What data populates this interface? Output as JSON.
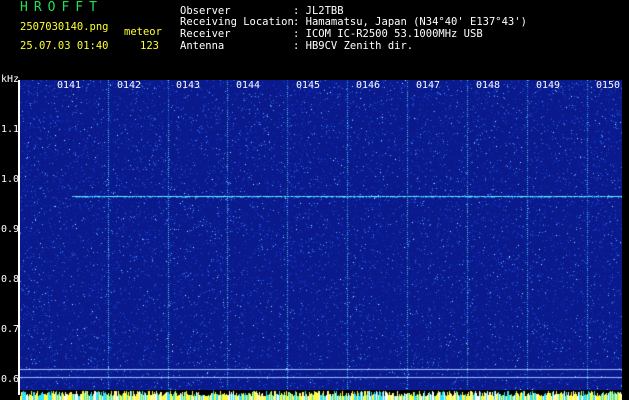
{
  "header": {
    "app_name": "HROFFT",
    "filename": "2507030140.png",
    "datetime": "25.07.03 01:40",
    "event_type": "meteor",
    "count": "123",
    "fields": [
      {
        "label": "Observer",
        "value": ": JL2TBB"
      },
      {
        "label": "Receiving Location",
        "value": ": Hamamatsu, Japan (N34°40' E137°43')"
      },
      {
        "label": "Receiver",
        "value": ": ICOM IC-R2500 53.1000MHz USB"
      },
      {
        "label": "Antenna",
        "value": ": HB9CV Zenith dir."
      }
    ]
  },
  "spectrogram": {
    "y_unit": "kHz",
    "y_ticks": [
      "1.1",
      "1.0",
      "0.9",
      "0.8",
      "0.7",
      "0.6"
    ],
    "time_labels": [
      "0141",
      "0142",
      "0143",
      "0144",
      "0145",
      "0146",
      "0147",
      "0148",
      "0149",
      "0150"
    ],
    "colors": {
      "background": "#0a1a8c",
      "signal": "#00e5ff",
      "text_yellow": "#ffff33",
      "text_green": "#22dd55"
    }
  }
}
